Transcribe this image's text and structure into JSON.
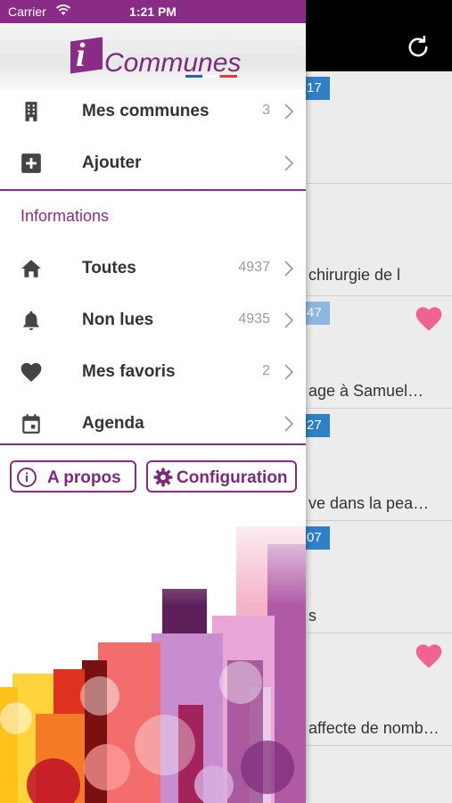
{
  "status_bar": {
    "carrier": "Carrier",
    "time": "1:21 PM"
  },
  "logo": {
    "text": "Communes",
    "accent_color": "#8a2c87"
  },
  "menu": {
    "items": [
      {
        "label": "Mes communes",
        "count": "3",
        "icon": "building-icon"
      },
      {
        "label": "Ajouter",
        "count": "",
        "icon": "plus-box-icon"
      }
    ]
  },
  "informations": {
    "header": "Informations",
    "items": [
      {
        "label": "Toutes",
        "count": "4937",
        "icon": "home-icon"
      },
      {
        "label": "Non lues",
        "count": "4935",
        "icon": "bell-icon"
      },
      {
        "label": "Mes favoris",
        "count": "2",
        "icon": "heart-icon"
      },
      {
        "label": "Agenda",
        "count": "",
        "icon": "calendar-icon"
      }
    ]
  },
  "footer_buttons": {
    "about": "A propos",
    "config": "Configuration"
  },
  "background_list": {
    "items": [
      {
        "badge": "17",
        "text": "",
        "favorite": false
      },
      {
        "badge": "",
        "text": "chirurgie de l",
        "favorite": false
      },
      {
        "badge": "47",
        "text": "age à Samuel…",
        "favorite": true
      },
      {
        "badge": "27",
        "text": "ve dans la pea…",
        "favorite": false
      },
      {
        "badge": "07",
        "text": "s",
        "favorite": false
      },
      {
        "badge": "",
        "text": "affecte de nomb…",
        "favorite": true
      }
    ]
  },
  "colors": {
    "brand": "#8a2c87",
    "badge": "#2f80c6",
    "heart": "#f06292"
  }
}
